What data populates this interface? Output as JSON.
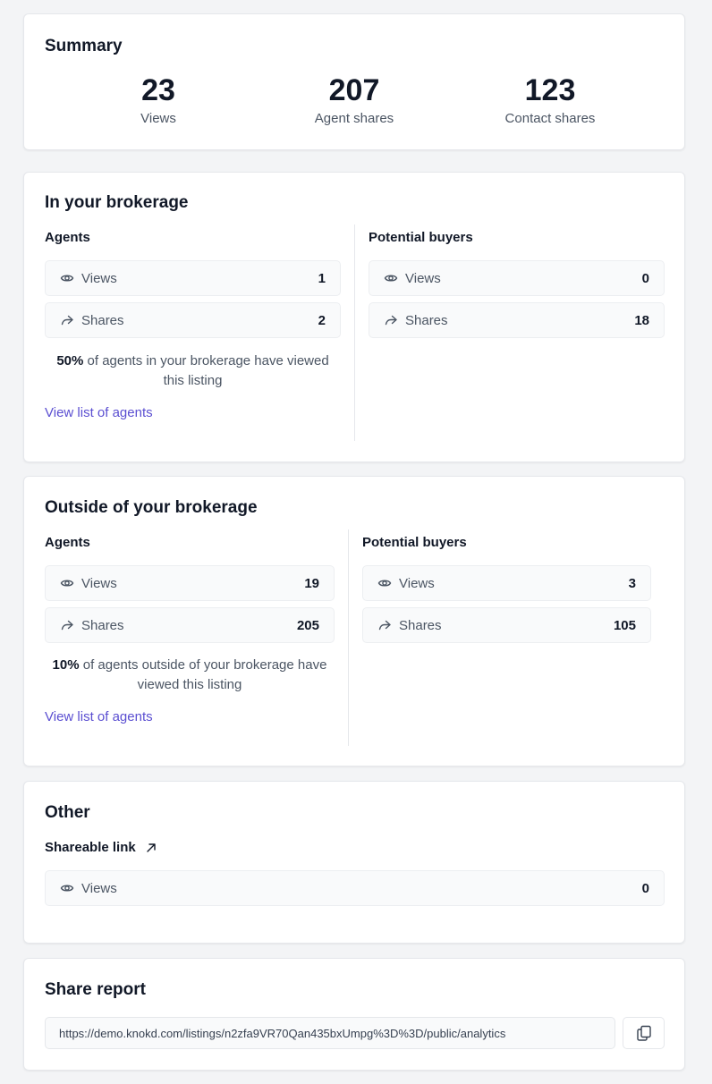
{
  "summary": {
    "title": "Summary",
    "stats": [
      {
        "value": "23",
        "label": "Views"
      },
      {
        "value": "207",
        "label": "Agent shares"
      },
      {
        "value": "123",
        "label": "Contact shares"
      }
    ]
  },
  "in_brokerage": {
    "title": "In your brokerage",
    "agents": {
      "title": "Agents",
      "views_label": "Views",
      "views_value": "1",
      "shares_label": "Shares",
      "shares_value": "2",
      "percent": "50%",
      "note_rest": " of agents in your brokerage have viewed this listing",
      "link": "View list of agents"
    },
    "buyers": {
      "title": "Potential buyers",
      "views_label": "Views",
      "views_value": "0",
      "shares_label": "Shares",
      "shares_value": "18"
    }
  },
  "outside_brokerage": {
    "title": "Outside of your brokerage",
    "agents": {
      "title": "Agents",
      "views_label": "Views",
      "views_value": "19",
      "shares_label": "Shares",
      "shares_value": "205",
      "percent": "10%",
      "note_rest": " of agents outside of your brokerage have viewed this listing",
      "link": "View list of agents"
    },
    "buyers": {
      "title": "Potential buyers",
      "views_label": "Views",
      "views_value": "3",
      "shares_label": "Shares",
      "shares_value": "105"
    }
  },
  "other": {
    "title": "Other",
    "shareable_link_label": "Shareable link",
    "views_label": "Views",
    "views_value": "0"
  },
  "share_report": {
    "title": "Share report",
    "url": "https://demo.knokd.com/listings/n2zfa9VR70Qan435bxUmpg%3D%3D/public/analytics"
  },
  "icons": {
    "views": "eye-icon",
    "shares": "share-arrow-icon",
    "external": "arrow-up-right-icon",
    "copy": "copy-icon"
  },
  "colors": {
    "link": "#5b4fd1",
    "background": "#f3f4f6"
  }
}
